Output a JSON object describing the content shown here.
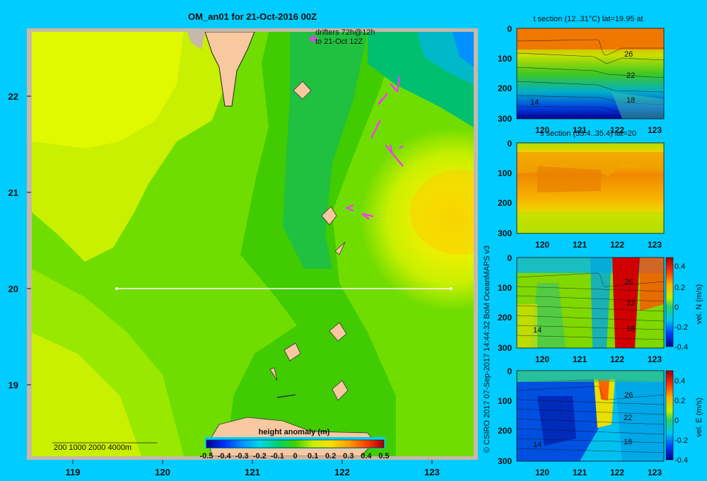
{
  "main_map": {
    "title": "OM_an01 for 21-Oct-2016 00Z",
    "drifter_note_line1": "drifters 72h@12h",
    "drifter_note_line2": "to 21-Oct 12Z",
    "lat_ticks": [
      "22",
      "21",
      "20",
      "19"
    ],
    "lon_ticks": [
      "119",
      "120",
      "121",
      "122",
      "123"
    ],
    "isobath_legend": "200  1000  2000  4000m",
    "colorbar_title": "height anomaly (m)",
    "colorbar_ticks": [
      "-0.5",
      "-0.4",
      "-0.3",
      "-0.2",
      "-0.1",
      "0",
      "0.1",
      "0.2",
      "0.3",
      "0.4",
      "0.5"
    ]
  },
  "credit": "© CSIRO 2017   07-Sep-2017 14:44:32 BoM OceanMAPS v3",
  "panels": [
    {
      "title": "t section (12..31°C) lat=19.95 at",
      "y_ticks": [
        "0",
        "100",
        "200",
        "300"
      ],
      "x_ticks": [
        "120",
        "121",
        "122",
        "123"
      ],
      "contour_labels": [
        "26",
        "22",
        "18",
        "14"
      ]
    },
    {
      "title": "s section (33.4..35.4) lat=20",
      "y_ticks": [
        "0",
        "100",
        "200",
        "300"
      ],
      "x_ticks": [
        "120",
        "121",
        "122",
        "123"
      ]
    },
    {
      "title": "",
      "y_ticks": [
        "0",
        "100",
        "200",
        "300"
      ],
      "x_ticks": [
        "120",
        "121",
        "122",
        "123"
      ],
      "contour_labels": [
        "26",
        "22",
        "18",
        "14"
      ],
      "colorbar_ticks": [
        "0.4",
        "0.2",
        "0",
        "-0.2",
        "-0.4"
      ],
      "colorbar_label": "vel. N (m/s)"
    },
    {
      "title": "",
      "y_ticks": [
        "0",
        "100",
        "200",
        "300"
      ],
      "x_ticks": [
        "120",
        "121",
        "122",
        "123"
      ],
      "contour_labels": [
        "26",
        "22",
        "18",
        "14"
      ],
      "colorbar_ticks": [
        "0.4",
        "0.2",
        "0",
        "-0.2",
        "-0.4"
      ],
      "colorbar_label": "vel. E (m/s)"
    }
  ],
  "colors": {
    "background": "#00ccff",
    "land": "#f8c8a0",
    "drifter": "#ff33ff",
    "section_line": "#ffffff"
  }
}
